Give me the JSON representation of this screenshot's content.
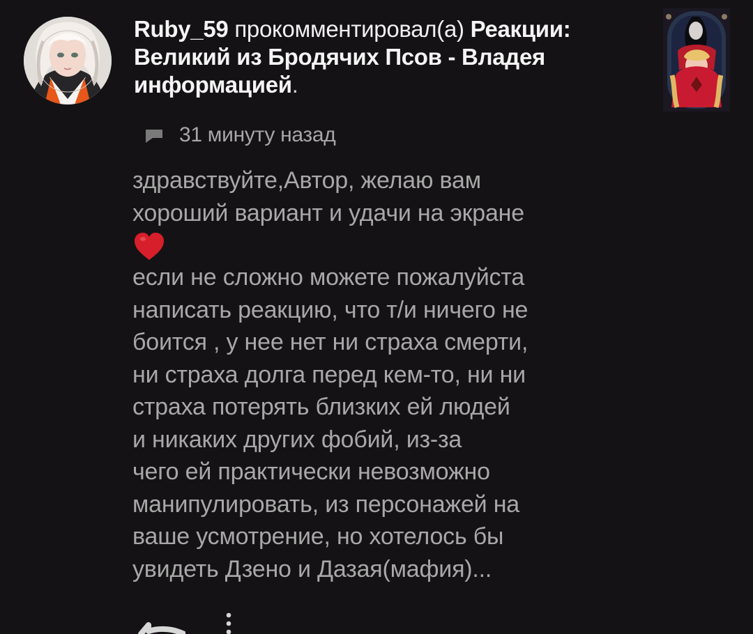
{
  "comment": {
    "author": "Ruby_59",
    "action": "прокомментировал(а)",
    "post_title": "Реакции: Великий из Бродячих Псов - Владея информацией",
    "period": ".",
    "time": "31 минуту назад",
    "text_lines": [
      "здравствуйте,Автор, желаю вам",
      "хороший вариант и удачи на экране"
    ],
    "emoji": "❤️",
    "text_lines_after": [
      "если не сложно можете пожалуйста",
      "написать реакцию, что т/и ничего не",
      "боится , у нее нет ни страха смерти,",
      "ни страха долга перед кем-то, ни ни",
      "страха потерять близких ей людей",
      "и никаких других фобий, из-за",
      "чего ей практически невозможно",
      "манипулировать, из персонажей на",
      "ваше усмотрение, но хотелось бы",
      "увидеть Дзено и Дазая(мафия)..."
    ]
  },
  "icons": {
    "comment": "comment-icon",
    "reply": "reply-icon",
    "more": "more-vertical-icon"
  }
}
